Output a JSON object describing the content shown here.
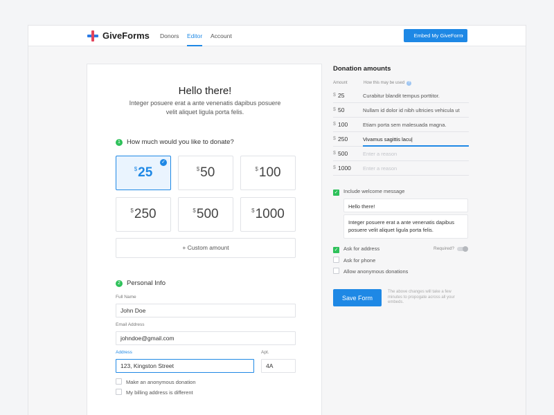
{
  "header": {
    "brand": "GiveForms",
    "nav": [
      {
        "label": "Donors",
        "active": false
      },
      {
        "label": "Editor",
        "active": true
      },
      {
        "label": "Account",
        "active": false
      }
    ],
    "embed_label": "Embed My GiveForm",
    "colors": {
      "accent": "#1e88e5",
      "logo_red": "#e2445c",
      "logo_blue": "#2b7be4",
      "success": "#2ec15a"
    }
  },
  "form": {
    "title": "Hello there!",
    "intro": "Integer posuere erat a ante venenatis dapibus posuere velit aliquet ligula porta felis.",
    "step1": {
      "num": "1",
      "label": "How much would you like to donate?"
    },
    "currency": "$",
    "amounts": [
      "25",
      "50",
      "100",
      "250",
      "500",
      "1000"
    ],
    "selected_amount": "25",
    "custom_label": "+  Custom amount",
    "step2": {
      "num": "2",
      "label": "Personal Info"
    },
    "full_name": {
      "label": "Full Name",
      "value": "John Doe"
    },
    "email": {
      "label": "Email Address",
      "value": "johndoe@gmail.com"
    },
    "address": {
      "label": "Address",
      "value": "123, Kingston Street"
    },
    "apt": {
      "label": "Apt.",
      "value": "4A"
    },
    "anonymous_label": "Make an anonymous donation",
    "billing_label": "My billing address is different"
  },
  "panel": {
    "title": "Donation amounts",
    "col_amount": "Amount",
    "col_usage": "How this may be used",
    "currency": "$",
    "rows": [
      {
        "amount": "25",
        "reason": "Curabitur blandit tempus porttitor.",
        "placeholder": false
      },
      {
        "amount": "50",
        "reason": "Nullam id dolor id nibh ultricies vehicula ut",
        "placeholder": false
      },
      {
        "amount": "100",
        "reason": "Etiam porta sem malesuada magna.",
        "placeholder": false
      },
      {
        "amount": "250",
        "reason": "Vivamus sagittis lacu|",
        "placeholder": false
      },
      {
        "amount": "500",
        "reason": "Enter a reason",
        "placeholder": true
      },
      {
        "amount": "1000",
        "reason": "Enter a reason",
        "placeholder": true
      }
    ],
    "include_welcome": {
      "label": "Include welcome message",
      "checked": true
    },
    "welcome_title": "Hello there!",
    "welcome_body": "Integer posuere erat a ante venenatis dapibus posuere velit aliquet ligula porta felis.",
    "ask_address": {
      "label": "Ask for address",
      "checked": true
    },
    "required_label": "Required?",
    "ask_phone": {
      "label": "Ask for phone",
      "checked": false
    },
    "allow_anonymous": {
      "label": "Allow anonymous donations",
      "checked": false
    },
    "save_label": "Save Form",
    "save_note": "The above changes will take a few minutes to propogate across all your embeds."
  }
}
